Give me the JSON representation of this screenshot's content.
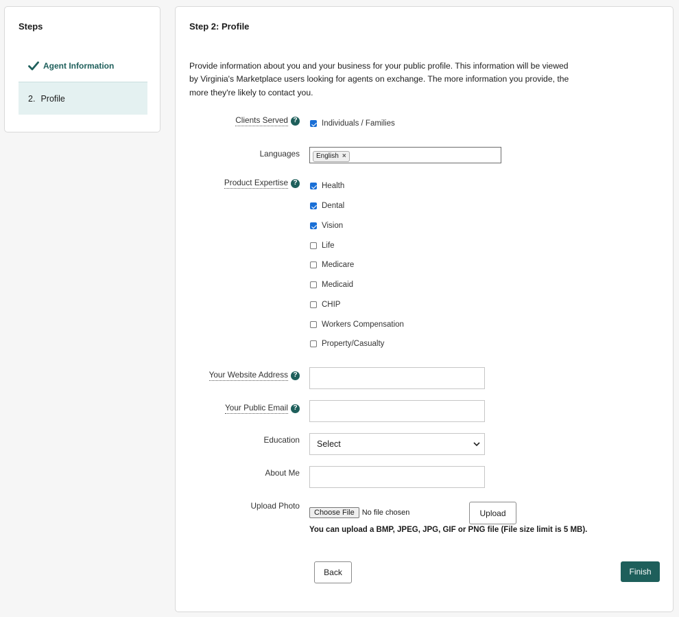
{
  "steps": {
    "title": "Steps",
    "items": [
      {
        "label": "Agent Information",
        "status": "completed"
      },
      {
        "number": "2.",
        "label": "Profile",
        "status": "current"
      }
    ]
  },
  "main": {
    "title": "Step 2: Profile",
    "intro": "Provide information about you and your business for your public profile. This information will be viewed by Virginia's Marketplace users looking for agents on exchange. The more information you provide, the more they're likely to contact you."
  },
  "form": {
    "clients_served": {
      "label": "Clients Served",
      "option": "Individuals / Families",
      "checked": true
    },
    "languages": {
      "label": "Languages",
      "tags": [
        "English"
      ],
      "remove_glyph": "×"
    },
    "product_expertise": {
      "label": "Product Expertise",
      "options": [
        {
          "label": "Health",
          "checked": true
        },
        {
          "label": "Dental",
          "checked": true
        },
        {
          "label": "Vision",
          "checked": true
        },
        {
          "label": "Life",
          "checked": false
        },
        {
          "label": "Medicare",
          "checked": false
        },
        {
          "label": "Medicaid",
          "checked": false
        },
        {
          "label": "CHIP",
          "checked": false
        },
        {
          "label": "Workers Compensation",
          "checked": false
        },
        {
          "label": "Property/Casualty",
          "checked": false
        }
      ]
    },
    "website": {
      "label": "Your Website Address",
      "value": ""
    },
    "public_email": {
      "label": "Your Public Email",
      "value": ""
    },
    "education": {
      "label": "Education",
      "selected": "Select"
    },
    "about_me": {
      "label": "About Me",
      "value": ""
    },
    "upload_photo": {
      "label": "Upload Photo",
      "choose_label": "Choose File",
      "file_status": "No file chosen",
      "upload_label": "Upload",
      "note": "You can upload a BMP, JPEG, JPG, GIF or PNG file (File size limit is 5 MB)."
    }
  },
  "actions": {
    "back_label": "Back",
    "finish_label": "Finish"
  },
  "help_glyph": "?",
  "colors": {
    "brand": "#1e5f5b",
    "current_step_bg": "#e4f1f1",
    "checkbox": "#1a6fd6"
  }
}
